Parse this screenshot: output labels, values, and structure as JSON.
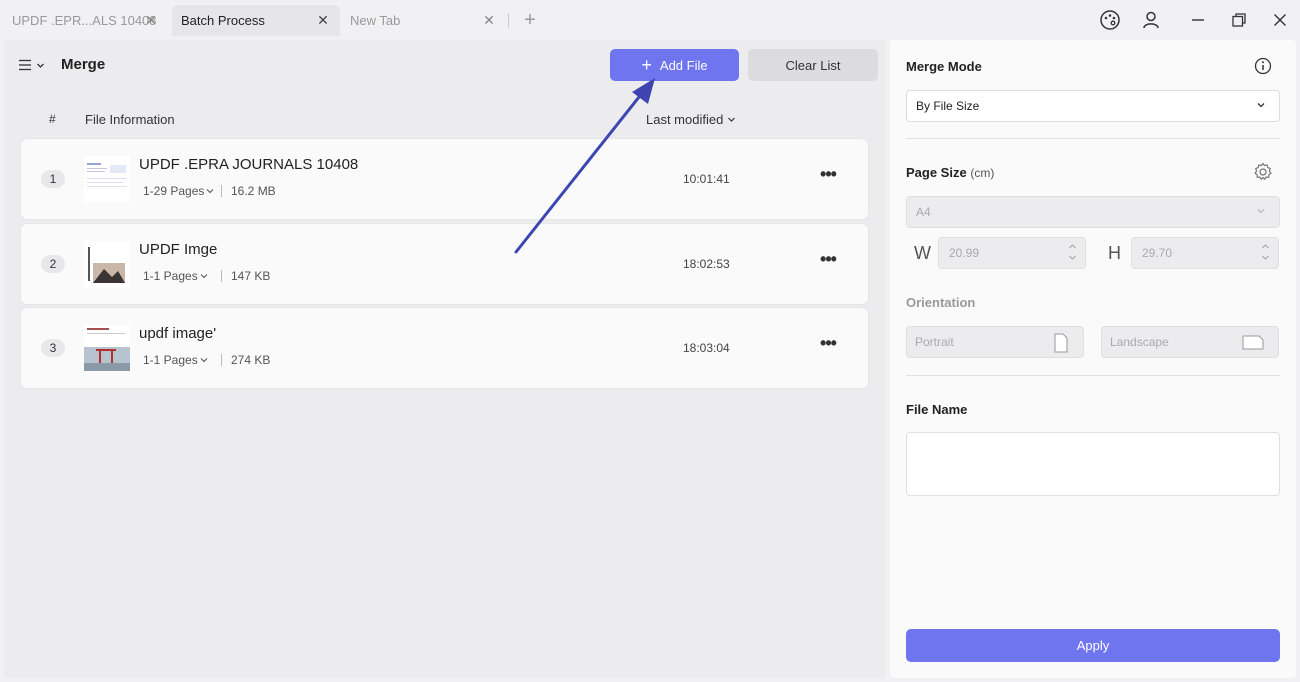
{
  "tabs": [
    {
      "label": "UPDF .EPR...ALS 10408",
      "active": false
    },
    {
      "label": "Batch Process",
      "active": true
    },
    {
      "label": "New Tab",
      "active": false
    }
  ],
  "window_icons": [
    "palette-icon",
    "user-icon",
    "minimize-icon",
    "restore-icon",
    "close-icon"
  ],
  "header": {
    "title": "Merge",
    "add_file_label": "Add File",
    "clear_list_label": "Clear List"
  },
  "columns": {
    "number": "#",
    "info": "File Information",
    "modified": "Last modified"
  },
  "files": [
    {
      "index": "1",
      "name": "UPDF .EPRA JOURNALS 10408",
      "pages": "1-29 Pages",
      "size": "16.2 MB",
      "time": "10:01:41"
    },
    {
      "index": "2",
      "name": "UPDF Imge",
      "pages": "1-1 Pages",
      "size": "147 KB",
      "time": "18:02:53"
    },
    {
      "index": "3",
      "name": "updf image'",
      "pages": "1-1 Pages",
      "size": "274 KB",
      "time": "18:03:04"
    }
  ],
  "settings": {
    "merge_mode_label": "Merge Mode",
    "merge_mode_value": "By File Size",
    "page_size_label": "Page Size",
    "page_size_unit": "(cm)",
    "page_size_value": "A4",
    "width_letter": "W",
    "width_value": "20.99",
    "height_letter": "H",
    "height_value": "29.70",
    "orientation_label": "Orientation",
    "portrait_label": "Portrait",
    "landscape_label": "Landscape",
    "file_name_label": "File Name",
    "file_name_value": "",
    "apply_label": "Apply"
  },
  "colors": {
    "accent": "#6f74ef",
    "annotation_arrow": "#3f45b0"
  }
}
